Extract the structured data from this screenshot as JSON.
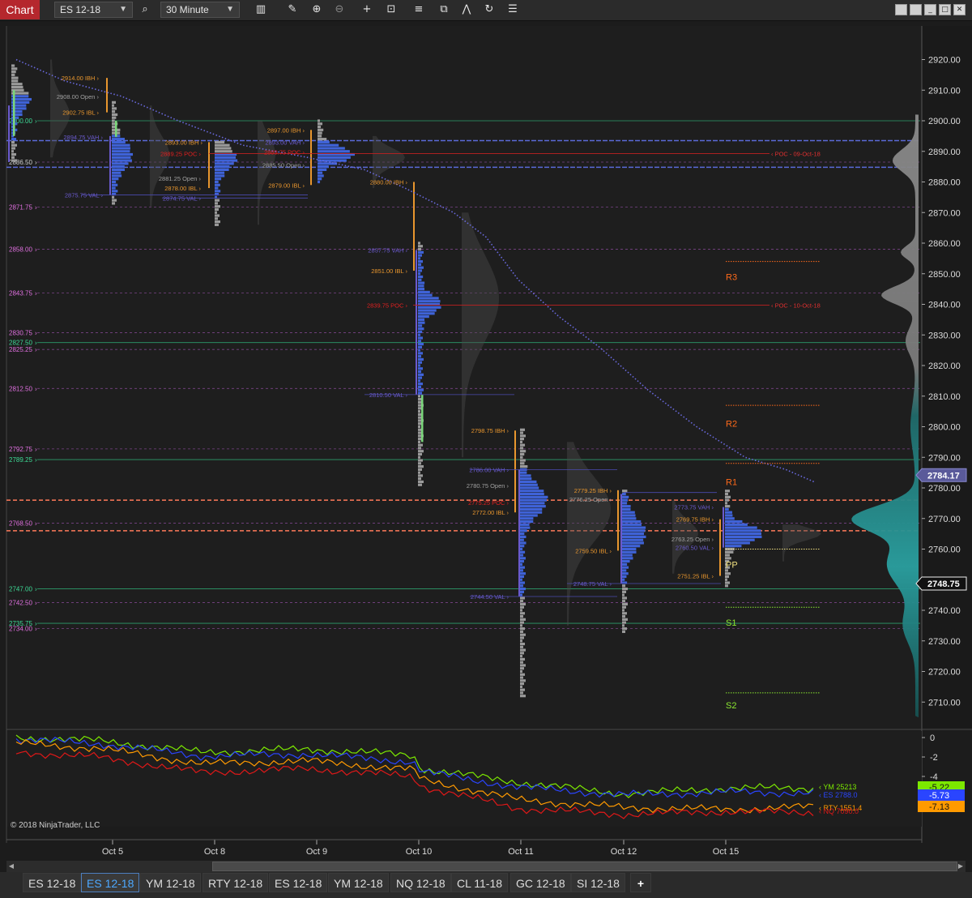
{
  "toolbar": {
    "chart_tab": "Chart",
    "instrument": "ES 12-18",
    "interval": "30 Minute",
    "icons": [
      "search-icon",
      "bar-chart-icon",
      "pencil-icon",
      "zoom-in-icon",
      "zoom-out-icon",
      "crosshair-icon",
      "data-box-icon",
      "properties-icon",
      "strategies-icon",
      "indicators-icon",
      "reload-icon",
      "list-icon"
    ]
  },
  "chart": {
    "copyright": "© 2018 NinjaTrader, LLC",
    "price_axis": [
      "2920.00",
      "2910.00",
      "2900.00",
      "2890.00",
      "2880.00",
      "2870.00",
      "2860.00",
      "2850.00",
      "2840.00",
      "2830.00",
      "2820.00",
      "2810.00",
      "2800.00",
      "2790.00",
      "2780.00",
      "2770.00",
      "2760.00",
      "2750.00",
      "2740.00",
      "2730.00",
      "2720.00",
      "2710.00"
    ],
    "current_price": "2784.17",
    "last_price": "2748.75",
    "date_labels": [
      "Oct 5",
      "Oct 8",
      "Oct 9",
      "Oct 10",
      "Oct 11",
      "Oct 12",
      "Oct 15"
    ],
    "left_levels": [
      {
        "text": "2900.00",
        "color": "#3ddc97"
      },
      {
        "text": "2886.50",
        "color": "#d0d0d0"
      },
      {
        "text": "2871.75",
        "color": "#e070e0"
      },
      {
        "text": "2858.00",
        "color": "#e070e0"
      },
      {
        "text": "2843.75",
        "color": "#e070e0"
      },
      {
        "text": "2830.75",
        "color": "#e070e0"
      },
      {
        "text": "2827.50",
        "color": "#3ddc97"
      },
      {
        "text": "2825.25",
        "color": "#e070e0"
      },
      {
        "text": "2812.50",
        "color": "#e070e0"
      },
      {
        "text": "2792.75",
        "color": "#e070e0"
      },
      {
        "text": "2789.25",
        "color": "#3ddc97"
      },
      {
        "text": "2768.50",
        "color": "#e070e0"
      },
      {
        "text": "2747.00",
        "color": "#3ddc97"
      },
      {
        "text": "2742.50",
        "color": "#e070e0"
      },
      {
        "text": "2735.75",
        "color": "#3ddc97"
      },
      {
        "text": "2734.00",
        "color": "#e070e0"
      }
    ],
    "profile_labels": [
      {
        "text": "2914.00 IBH",
        "color": "#e8962e"
      },
      {
        "text": "2908.00 Open",
        "color": "#a0a0a0"
      },
      {
        "text": "2902.75 IBL",
        "color": "#e8962e"
      },
      {
        "text": "2894.75 VAH",
        "color": "#6a5acd"
      },
      {
        "text": "2875.75 VAL",
        "color": "#6a5acd"
      },
      {
        "text": "2893.00 IBH",
        "color": "#e8962e"
      },
      {
        "text": "2889.25 POC",
        "color": "#e02020"
      },
      {
        "text": "2881.25 Open",
        "color": "#a0a0a0"
      },
      {
        "text": "2878.00 IBL",
        "color": "#e8962e"
      },
      {
        "text": "2874.75 VAL",
        "color": "#6a5acd"
      },
      {
        "text": "2897.00 IBH",
        "color": "#e8962e"
      },
      {
        "text": "2893.00 VAH",
        "color": "#6a5acd"
      },
      {
        "text": "2889.75 POC",
        "color": "#e02020"
      },
      {
        "text": "2885.50 Open",
        "color": "#a0a0a0"
      },
      {
        "text": "2879.00 IBL",
        "color": "#e8962e"
      },
      {
        "text": "2880.00 IBH",
        "color": "#e8962e"
      },
      {
        "text": "2857.75 VAH",
        "color": "#6a5acd"
      },
      {
        "text": "2851.00 IBL",
        "color": "#e8962e"
      },
      {
        "text": "2839.75 POC",
        "color": "#e02020"
      },
      {
        "text": "2810.50 VAL",
        "color": "#6a5acd"
      },
      {
        "text": "2798.75 IBH",
        "color": "#e8962e"
      },
      {
        "text": "2786.00 VAH",
        "color": "#6a5acd"
      },
      {
        "text": "2780.75 Open",
        "color": "#a0a0a0"
      },
      {
        "text": "2775.25 POC",
        "color": "#e02020"
      },
      {
        "text": "2772.00 IBL",
        "color": "#e8962e"
      },
      {
        "text": "2744.50 VAL",
        "color": "#6a5acd"
      },
      {
        "text": "2779.25 IBH",
        "color": "#e8962e"
      },
      {
        "text": "2776.25 Open",
        "color": "#a0a0a0"
      },
      {
        "text": "2759.50 IBL",
        "color": "#e8962e"
      },
      {
        "text": "2748.75 VAL",
        "color": "#6a5acd"
      },
      {
        "text": "2773.75 VAH",
        "color": "#6a5acd"
      },
      {
        "text": "2769.75 IBH",
        "color": "#e8962e"
      },
      {
        "text": "2763.25 Open",
        "color": "#a0a0a0"
      },
      {
        "text": "2760.50 VAL",
        "color": "#6a5acd"
      },
      {
        "text": "2751.25 IBL",
        "color": "#e8962e"
      }
    ],
    "poc_tags": [
      "POC - 09-Oct-18",
      "POC - 10-Oct-18"
    ],
    "pivots": [
      {
        "text": "R3",
        "color": "#ff6a1a"
      },
      {
        "text": "R2",
        "color": "#ff6a1a"
      },
      {
        "text": "R1",
        "color": "#ff6a1a"
      },
      {
        "text": "PP",
        "color": "#f0e080"
      },
      {
        "text": "S1",
        "color": "#8be830"
      },
      {
        "text": "S2",
        "color": "#8be830"
      }
    ],
    "lower_panel": {
      "axis": [
        "0",
        "-2",
        "-4",
        "-6"
      ],
      "series_labels": [
        {
          "text": "YM 25213",
          "color": "#7ce800"
        },
        {
          "text": "ES 2788.0",
          "color": "#2a45ff"
        },
        {
          "text": "RTY 1551.4",
          "color": "#ff9a00"
        },
        {
          "text": "NQ 7090.0",
          "color": "#e01818"
        }
      ],
      "value_badges": [
        {
          "text": "-5.22",
          "color": "#7ce800"
        },
        {
          "text": "-5.73",
          "color": "#2a45ff"
        },
        {
          "text": "-7.13",
          "color": "#ff9a00"
        }
      ]
    }
  },
  "tabs": [
    "ES 12-18",
    "ES 12-18",
    "YM 12-18",
    "RTY 12-18",
    "ES 12-18",
    "YM 12-18",
    "NQ 12-18",
    "CL 11-18",
    "GC 12-18",
    "SI 12-18"
  ],
  "active_tab": "ES 12-18",
  "add_tab": "+"
}
